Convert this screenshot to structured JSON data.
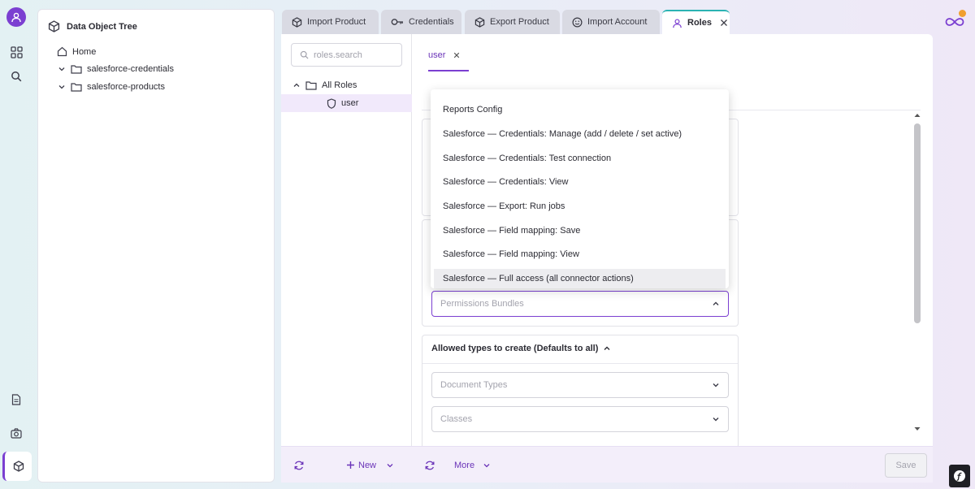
{
  "tree": {
    "title": "Data Object Tree",
    "items": [
      {
        "label": "Home",
        "icon": "home-icon"
      },
      {
        "label": "salesforce-credentials",
        "icon": "folder-icon"
      },
      {
        "label": "salesforce-products",
        "icon": "folder-icon"
      }
    ]
  },
  "tabs": [
    {
      "label": "Import Product",
      "icon": "cube-icon"
    },
    {
      "label": "Credentials",
      "icon": "key-icon"
    },
    {
      "label": "Export Product",
      "icon": "cube-icon"
    },
    {
      "label": "Import Account",
      "icon": "smiley-icon"
    },
    {
      "label": "Roles",
      "icon": "user-icon",
      "active": true
    }
  ],
  "roles": {
    "search_placeholder": "roles.search",
    "root": "All Roles",
    "items": [
      {
        "label": "user"
      }
    ],
    "new_label": "New"
  },
  "detail": {
    "subtab": "user",
    "more_label": "More",
    "save_label": "Save",
    "permissions_placeholder": "Permissions Bundles",
    "allowed_types_title": "Allowed types to create (Defaults to all)",
    "document_types_placeholder": "Document Types",
    "classes_placeholder": "Classes"
  },
  "dropdown": {
    "options": [
      "Reports Config",
      "Salesforce — Credentials: Manage (add / delete / set active)",
      "Salesforce — Credentials: Test connection",
      "Salesforce — Credentials: View",
      "Salesforce — Export: Run jobs",
      "Salesforce — Field mapping: Save",
      "Salesforce — Field mapping: View",
      "Salesforce — Full access (all connector actions)"
    ],
    "highlighted_index": 7
  },
  "colors": {
    "accent": "#7b3fd1",
    "tab_active_border": "#2bb3b3",
    "notification": "#f0a030"
  }
}
